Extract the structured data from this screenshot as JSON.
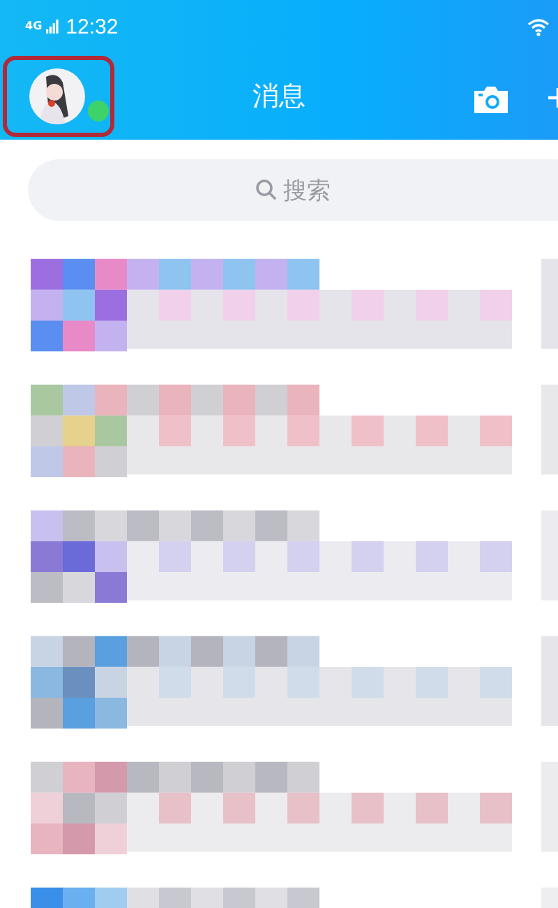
{
  "status_bar": {
    "network": "4G",
    "time": "12:32"
  },
  "header": {
    "title": "消息",
    "avatar": {
      "online": true,
      "highlighted": true
    }
  },
  "search": {
    "placeholder": "搜索"
  }
}
